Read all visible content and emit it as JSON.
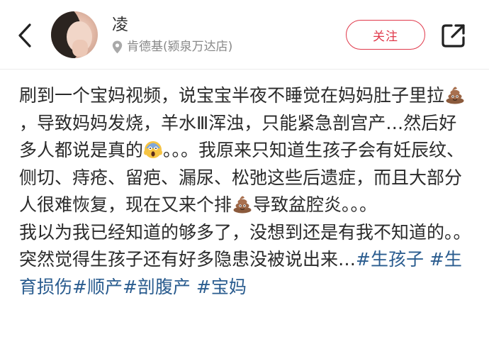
{
  "header": {
    "username": "凌",
    "location": "肯德基(颍泉万达店)",
    "follow_label": "关注"
  },
  "post": {
    "p1_s1": "刷到一个宝妈视频，说宝宝半夜不睡觉在妈妈肚子里拉",
    "p1_s2": "，导致妈妈发烧，羊水Ⅲ浑浊，只能紧急剖宫产…然后好多人都说是真的",
    "p1_s3": "。。。我原来只知道生孩子会有妊辰纹、侧切、痔疮、留疤、漏尿、松弛这些后遗症，而且大部分人很难恢复，现在又来个排",
    "p1_s4": "导致盆腔炎。。。",
    "p2": "我以为我已经知道的够多了，没想到还是有我不知道的。。突然觉得生孩子还有好多隐患没被说出来…",
    "tags": [
      "#生孩子",
      "#生育损伤",
      "#顺产",
      "#剖腹产",
      "#宝妈"
    ]
  },
  "icons": {
    "back": "chevron-left-icon",
    "location": "location-pin-icon",
    "share": "share-icon",
    "poop": "poop-emoji",
    "scream": "face-screaming-emoji"
  },
  "colors": {
    "accent": "#e0394b",
    "tag": "#2a5c8f",
    "muted": "#888888"
  }
}
